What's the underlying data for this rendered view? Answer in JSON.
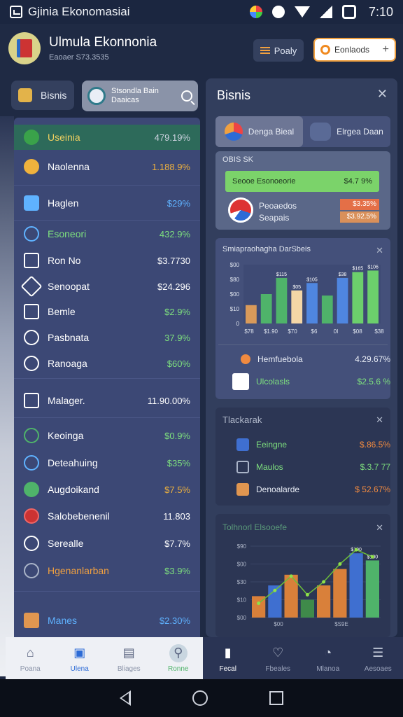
{
  "status_bar": {
    "app_name": "Gjinia Ekonomasiai",
    "time": "7:10"
  },
  "header": {
    "title": "Ulmula Ekonnonia",
    "subtitle": "Eaoaer S73.3535",
    "filter_label": "Poaly",
    "search_label": "Eonlaods"
  },
  "left": {
    "chip_label": "Bisnis",
    "search_text_1": "Stsondla Bain",
    "search_text_2": "Daaicas",
    "items": [
      {
        "label": "Useinia",
        "value": "479.19%",
        "color": "#f0d060",
        "vcolor": "#cdd3e0"
      },
      {
        "label": "Naolenna",
        "value": "1.188.9%",
        "color": "#ffffff",
        "vcolor": "#f0b23d"
      },
      {
        "label": "Haglen",
        "value": "$29%",
        "color": "#ffffff",
        "vcolor": "#5fb2ff"
      },
      {
        "label": "Esoneori",
        "value": "432.9%",
        "color": "#7ee07e",
        "vcolor": "#7ee07e"
      },
      {
        "label": "Ron No",
        "value": "$3.7730",
        "color": "#ffffff",
        "vcolor": "#ffffff"
      },
      {
        "label": "Senoopat",
        "value": "$24.296",
        "color": "#ffffff",
        "vcolor": "#ffffff"
      },
      {
        "label": "Bemle",
        "value": "$2.9%",
        "color": "#ffffff",
        "vcolor": "#7ee07e"
      },
      {
        "label": "Pasbnata",
        "value": "37.9%",
        "color": "#ffffff",
        "vcolor": "#7ee07e"
      },
      {
        "label": "Ranoaga",
        "value": "$60%",
        "color": "#ffffff",
        "vcolor": "#7ee07e"
      },
      {
        "label": "Malager.",
        "value": "11.90.00%",
        "color": "#ffffff",
        "vcolor": "#ffffff"
      },
      {
        "label": "Keoinga",
        "value": "$0.9%",
        "color": "#ffffff",
        "vcolor": "#7ee07e"
      },
      {
        "label": "Deteahuing",
        "value": "$35%",
        "color": "#ffffff",
        "vcolor": "#7ee07e"
      },
      {
        "label": "Augdoikand",
        "value": "$7.5%",
        "color": "#ffffff",
        "vcolor": "#f0b23d"
      },
      {
        "label": "Salobebenenil",
        "value": "11.803",
        "color": "#ffffff",
        "vcolor": "#ffffff"
      },
      {
        "label": "Serealle",
        "value": "$7.7%",
        "color": "#ffffff",
        "vcolor": "#ffffff"
      },
      {
        "label": "Hgenanlarban",
        "value": "$3.9%",
        "color": "#f0a040",
        "vcolor": "#7ee07e"
      },
      {
        "label": "Manes",
        "value": "$2.30%",
        "color": "#5fb2ff",
        "vcolor": "#5fb2ff"
      }
    ]
  },
  "right": {
    "title": "Bisnis",
    "seg_1": "Denga Bieal",
    "seg_2": "Elrgea Daan",
    "card1": {
      "header": "OBIS SK",
      "green_label": "Seooe Esonoeorie",
      "green_value": "$4.7 9%",
      "row_label_1": "Peoaedos",
      "row_label_2": "Seapais",
      "tag_1": "$3.35%",
      "tag_2": "$3.92.5%"
    },
    "card2": {
      "header": "Smiapraohagha DarSbeis",
      "row_1_label": "Hemfuebola",
      "row_1_value": "4.29.67%",
      "row_2_label": "Ulcolasls",
      "row_2_value": "$2.5.6 %"
    },
    "card3": {
      "header": "Tlackarak",
      "rows": [
        {
          "label": "Eeingne",
          "value": "$.86.5%",
          "vcolor": "#f08a40"
        },
        {
          "label": "Maulos",
          "value": "$.3.7 77",
          "vcolor": "#7ee07e"
        },
        {
          "label": "Denoalarde",
          "value": "$ 52.67%",
          "vcolor": "#f08a40"
        }
      ]
    },
    "card4": {
      "header": "Tolhnorl Elsooefe"
    }
  },
  "chart_data": [
    {
      "type": "bar",
      "title": "Smiapraohagha DarSbeis",
      "categories": [
        "$78",
        "$1.90",
        "$70",
        "$6",
        "0I",
        "$08",
        "$38"
      ],
      "y_ticks": [
        "$00",
        "$80",
        "$00",
        "$10",
        "0"
      ],
      "x_ticks": [
        "$78",
        "$1.90",
        "$70",
        "$6",
        "0I",
        "$08",
        "$38"
      ],
      "series": [
        {
          "values": [
            25,
            40,
            62,
            45,
            55,
            38,
            62,
            70,
            72
          ]
        }
      ],
      "bar_labels": [
        "",
        "",
        "$115",
        "$05",
        "$105",
        "",
        "$38",
        "$165",
        "$106"
      ],
      "bar_colors": [
        "#d99a5a",
        "#4fb36a",
        "#4fb36a",
        "#f4d6a6",
        "#4f86e0",
        "#4fb36a",
        "#4f86e0",
        "#6ccf6c",
        "#6ccf6c"
      ]
    },
    {
      "type": "bar",
      "title": "Tolhnorl Elsooefe",
      "y_ticks": [
        "$90",
        "$00",
        "$30",
        "$10",
        "$00"
      ],
      "x_ticks": [
        "$00",
        "$S9E"
      ],
      "series": [
        {
          "values": [
            30,
            45,
            60,
            25,
            45,
            68,
            90,
            80
          ]
        },
        {
          "type": "line",
          "values": [
            20,
            38,
            58,
            32,
            50,
            75,
            95,
            85
          ]
        }
      ],
      "bar_labels": [
        "",
        "",
        "",
        "",
        "",
        "",
        "$190",
        "$100"
      ],
      "bar_colors": [
        "#d9803a",
        "#3f6fd0",
        "#d9803a",
        "#3f8a4a",
        "#d9803a",
        "#d9803a",
        "#3f6fd0",
        "#4fb36a"
      ]
    }
  ],
  "bottom_nav_left": [
    {
      "label": "Poana",
      "icon": "home-icon"
    },
    {
      "label": "Ulena",
      "icon": "building-icon"
    },
    {
      "label": "Bliages",
      "icon": "document-icon"
    },
    {
      "label": "Ronne",
      "icon": "search-icon"
    }
  ],
  "bottom_nav_right": [
    {
      "label": "Fecal",
      "icon": "tablet-icon"
    },
    {
      "label": "Fbeales",
      "icon": "heart-icon"
    },
    {
      "label": "Mlanoa",
      "icon": "clock-icon"
    },
    {
      "label": "Aesoaes",
      "icon": "menu-icon"
    }
  ]
}
